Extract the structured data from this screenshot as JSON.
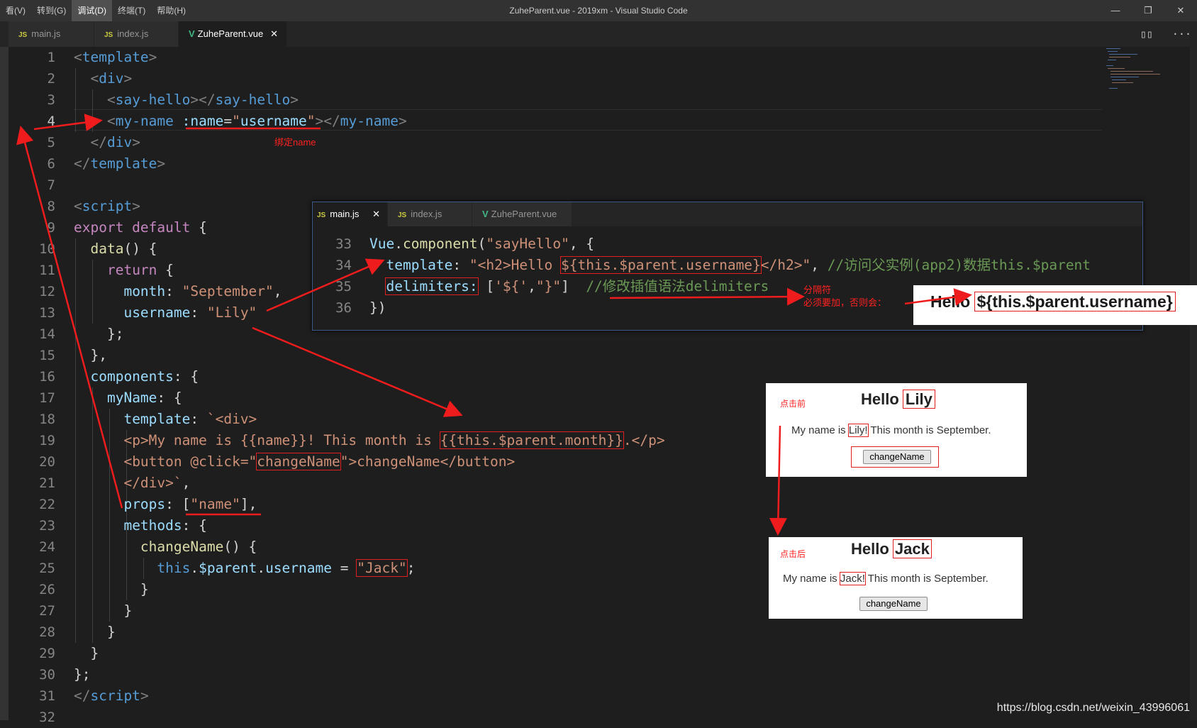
{
  "window": {
    "menu": [
      "看(V)",
      "转到(G)",
      "调试(D)",
      "终端(T)",
      "帮助(H)"
    ],
    "title": "ZuheParent.vue - 2019xm - Visual Studio Code",
    "controls": [
      "—",
      "❐",
      "✕"
    ]
  },
  "tabs": [
    {
      "label": "main.js",
      "icon": "JS"
    },
    {
      "label": "index.js",
      "icon": "JS"
    },
    {
      "label": "ZuheParent.vue",
      "icon": "V",
      "active": true,
      "close": "✕"
    }
  ],
  "editor": {
    "current_line": 4,
    "lines": [
      {
        "n": "1"
      },
      {
        "n": "2"
      },
      {
        "n": "3"
      },
      {
        "n": "4"
      },
      {
        "n": "5"
      },
      {
        "n": "6"
      },
      {
        "n": "7"
      },
      {
        "n": "8"
      },
      {
        "n": "9"
      },
      {
        "n": "10"
      },
      {
        "n": "11"
      },
      {
        "n": "12"
      },
      {
        "n": "13"
      },
      {
        "n": "14"
      },
      {
        "n": "15"
      },
      {
        "n": "16"
      },
      {
        "n": "17"
      },
      {
        "n": "18"
      },
      {
        "n": "19"
      },
      {
        "n": "20"
      },
      {
        "n": "21"
      },
      {
        "n": "22"
      },
      {
        "n": "23"
      },
      {
        "n": "24"
      },
      {
        "n": "25"
      },
      {
        "n": "26"
      },
      {
        "n": "27"
      },
      {
        "n": "28"
      },
      {
        "n": "29"
      },
      {
        "n": "30"
      },
      {
        "n": "31"
      },
      {
        "n": "32"
      }
    ]
  },
  "inset": {
    "tabs": [
      {
        "label": "main.js",
        "icon": "JS",
        "active": true,
        "close": "✕"
      },
      {
        "label": "index.js",
        "icon": "JS"
      },
      {
        "label": "ZuheParent.vue",
        "icon": "V"
      }
    ],
    "line_numbers": [
      "33",
      "34",
      "35",
      "36"
    ]
  },
  "annotations": {
    "bind_name": "绑定name",
    "delimiter": "分隔符",
    "must_add": "必须要加，否则会：",
    "before_click": "点击前",
    "after_click": "点击后"
  },
  "result_strip": {
    "hello": "Hello",
    "raw": "${this.$parent.username}"
  },
  "panel_before": {
    "hello": "Hello",
    "name": "Lily",
    "p1": "My name is ",
    "p_name": "Lily!",
    "p2": " This month is September.",
    "button": "changeName"
  },
  "panel_after": {
    "hello": "Hello",
    "name": "Jack",
    "p1": "My name is ",
    "p_name": "Jack!",
    "p2": " This month is September.",
    "button": "changeName"
  },
  "watermark": "https://blog.csdn.net/weixin_43996061",
  "colors": {
    "accent_red": "#ff2020",
    "editor_bg": "#1e1e1e",
    "tag": "#569cd6",
    "string": "#ce9178",
    "attr": "#9cdcfe"
  }
}
